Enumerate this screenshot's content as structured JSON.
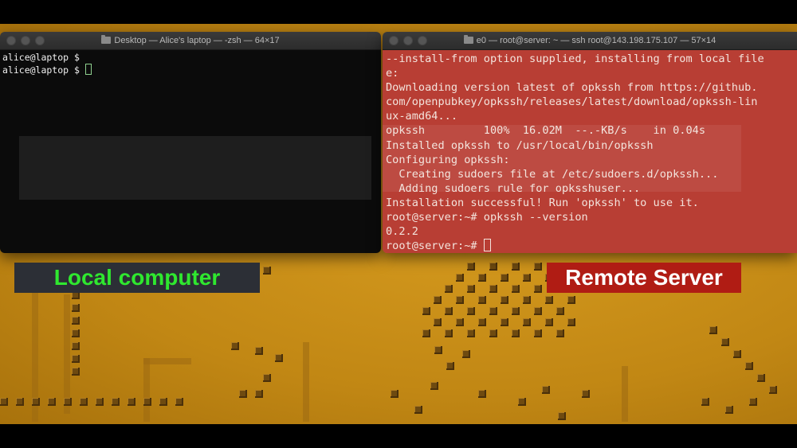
{
  "local_window": {
    "title": "Desktop — Alice's laptop — -zsh — 64×17",
    "lines": [
      "alice@laptop $",
      "alice@laptop $ "
    ]
  },
  "remote_window": {
    "title": "e0 — root@server: ~ — ssh root@143.198.175.107 — 57×14",
    "lines": [
      "--install-from option supplied, installing from local file",
      "e:",
      "Downloading version latest of opkssh from https://github.",
      "com/openpubkey/opkssh/releases/latest/download/opkssh-lin",
      "ux-amd64...",
      "opkssh         100%  16.02M  --.-KB/s    in 0.04s",
      "Installed opkssh to /usr/local/bin/opkssh",
      "Configuring opkssh:",
      "  Creating sudoers file at /etc/sudoers.d/opkssh...",
      "  Adding sudoers rule for opksshuser...",
      "Installation successful! Run 'opkssh' to use it.",
      "root@server:~# opkssh --version",
      "0.2.2",
      "root@server:~# "
    ]
  },
  "labels": {
    "local": "Local computer",
    "remote": "Remote Server"
  },
  "colors": {
    "local_label_text": "#2fe82f",
    "remote_label_bg": "#b01c14",
    "remote_terminal_bg": "#b83e34",
    "wallpaper": "#c88f18"
  }
}
